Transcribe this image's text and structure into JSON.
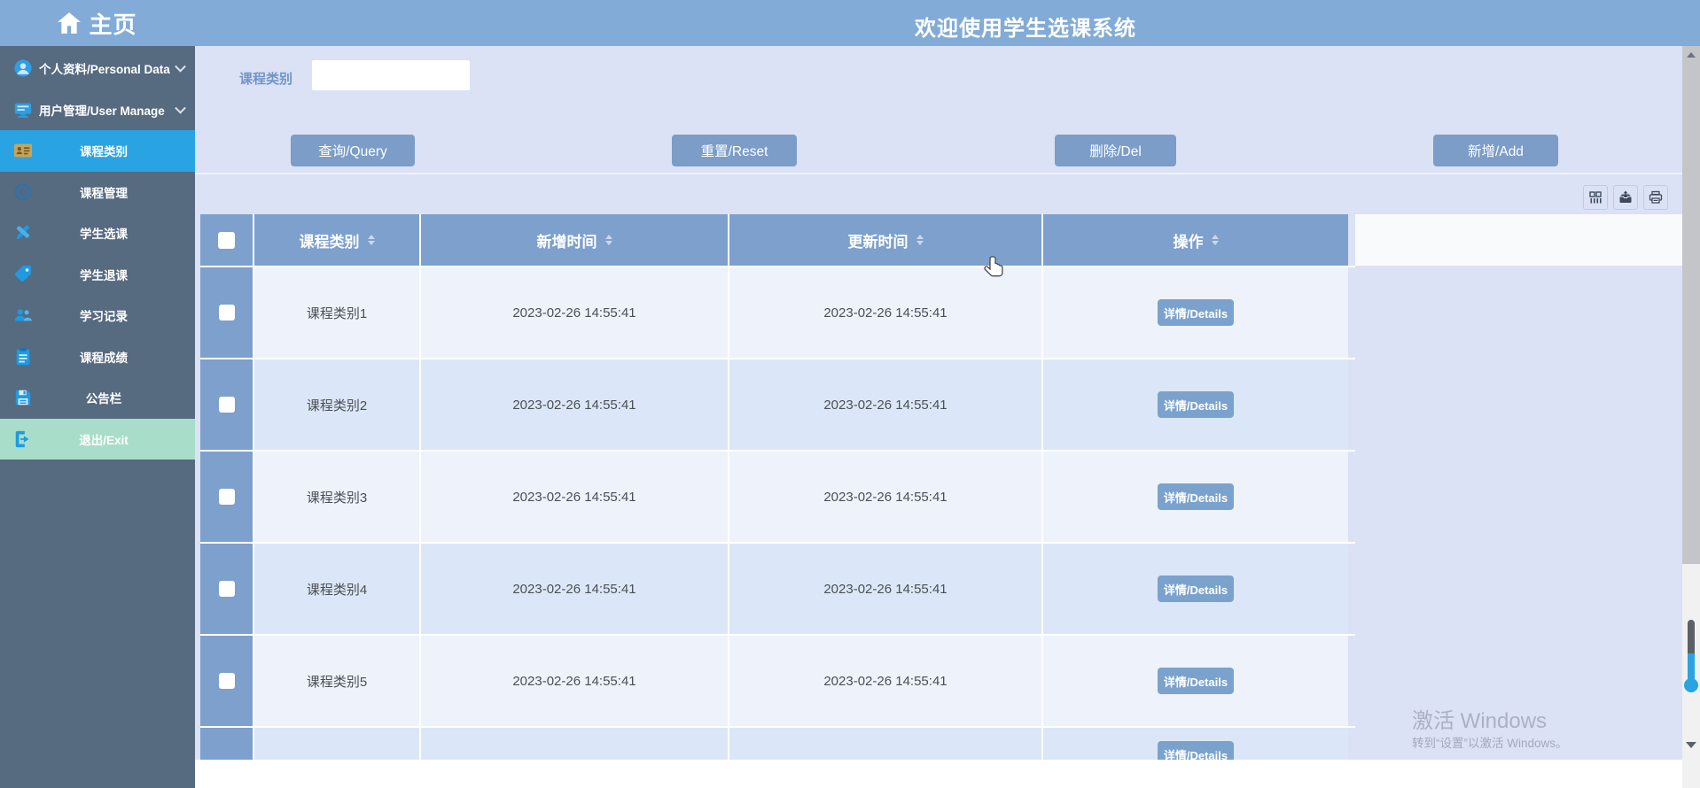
{
  "header": {
    "title": "欢迎使用学生选课系统"
  },
  "sidebar": {
    "home_label": "主页",
    "items": [
      {
        "label": "个人资料/Personal Data",
        "icon": "user-avatar-icon",
        "expandable": true,
        "active": false
      },
      {
        "label": "用户管理/User Manage",
        "icon": "monitor-icon",
        "expandable": true,
        "active": false
      },
      {
        "label": "课程类别",
        "icon": "id-card-icon",
        "active": true
      },
      {
        "label": "课程管理",
        "icon": "ring-icon",
        "active": false
      },
      {
        "label": "学生选课",
        "icon": "pen-icon",
        "active": false
      },
      {
        "label": "学生退课",
        "icon": "tag-icon",
        "active": false
      },
      {
        "label": "学习记录",
        "icon": "people-icon",
        "active": false
      },
      {
        "label": "课程成绩",
        "icon": "clipboard-icon",
        "active": false
      },
      {
        "label": "公告栏",
        "icon": "board-icon",
        "active": false
      },
      {
        "label": "退出/Exit",
        "icon": "logout-icon",
        "active": false,
        "exit": true
      }
    ]
  },
  "search": {
    "label": "课程类别",
    "value": "",
    "placeholder": ""
  },
  "buttons": {
    "query": "查询/Query",
    "reset": "重置/Reset",
    "delete": "删除/Del",
    "add": "新增/Add"
  },
  "toolbar_icons": [
    "columns-icon",
    "export-icon",
    "print-icon"
  ],
  "table": {
    "columns": [
      "课程类别",
      "新增时间",
      "更新时间",
      "操作"
    ],
    "detail_label": "详情/Details",
    "rows": [
      {
        "category": "课程类别1",
        "created": "2023-02-26 14:55:41",
        "updated": "2023-02-26 14:55:41"
      },
      {
        "category": "课程类别2",
        "created": "2023-02-26 14:55:41",
        "updated": "2023-02-26 14:55:41"
      },
      {
        "category": "课程类别3",
        "created": "2023-02-26 14:55:41",
        "updated": "2023-02-26 14:55:41"
      },
      {
        "category": "课程类别4",
        "created": "2023-02-26 14:55:41",
        "updated": "2023-02-26 14:55:41"
      },
      {
        "category": "课程类别5",
        "created": "2023-02-26 14:55:41",
        "updated": "2023-02-26 14:55:41"
      }
    ],
    "partial_sixth_row_visible": true
  },
  "watermark": {
    "line1": "激活 Windows",
    "line2": "转到“设置”以激活 Windows。"
  },
  "colors": {
    "topbar_blue": "#82abd7",
    "sidebar_bg": "#566a80",
    "sidebar_active_blue": "#29a3e2",
    "sidebar_exit_mint": "#a7ddc9",
    "content_bg": "#dce2f5",
    "button_blue": "#7b9dc8",
    "table_header_blue": "#7da0cc",
    "row_light": "#eef2fb",
    "row_blue": "#dbe7f8",
    "active_icon_gold": "#c9a455",
    "icon_blue": "#1e9ae0",
    "thermo_blue": "#2aa3e3"
  }
}
